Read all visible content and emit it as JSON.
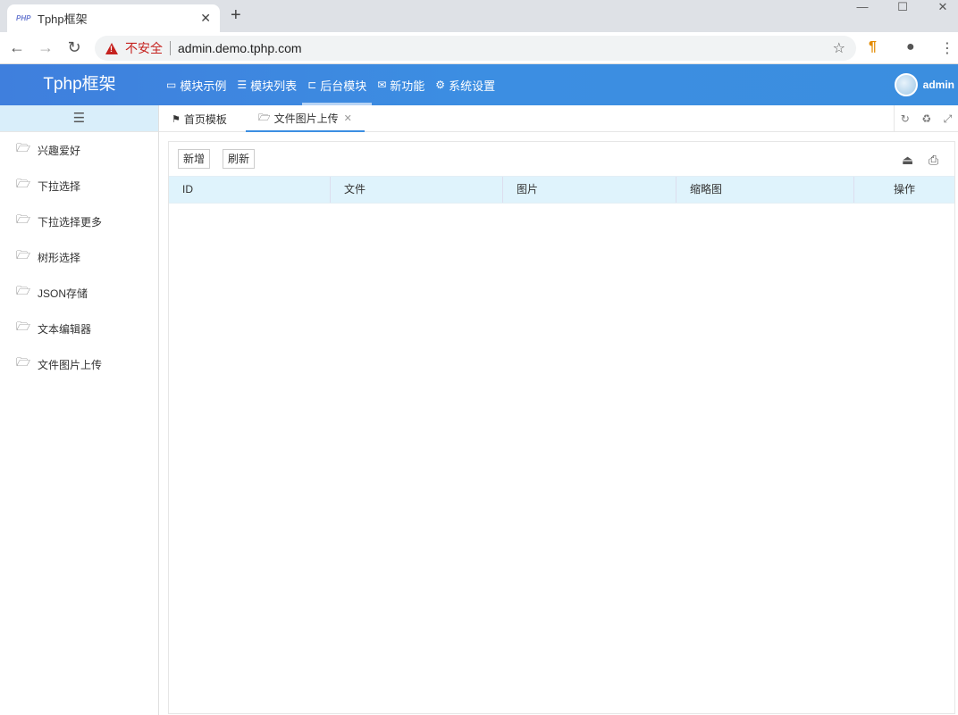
{
  "browser": {
    "tab_title": "Tphp框架",
    "favicon_text": "PHP",
    "security_label": "不安全",
    "url": "admin.demo.tphp.com"
  },
  "header": {
    "logo": "Tphp框架",
    "nav": [
      {
        "label": "模块示例",
        "icon": "monitor-icon"
      },
      {
        "label": "模块列表",
        "icon": "list-icon"
      },
      {
        "label": "后台模块",
        "icon": "laptop-icon",
        "active": true
      },
      {
        "label": "新功能",
        "icon": "envelope-open-icon"
      },
      {
        "label": "系统设置",
        "icon": "gear-icon"
      }
    ],
    "user": "admin"
  },
  "sidebar": {
    "items": [
      {
        "label": "兴趣爱好"
      },
      {
        "label": "下拉选择"
      },
      {
        "label": "下拉选择更多"
      },
      {
        "label": "树形选择"
      },
      {
        "label": "JSON存储"
      },
      {
        "label": "文本编辑器"
      },
      {
        "label": "文件图片上传"
      }
    ]
  },
  "content_tabs": [
    {
      "label": "首页模板",
      "icon": "flag-icon"
    },
    {
      "label": "文件图片上传",
      "icon": "folder-open-icon",
      "active": true
    }
  ],
  "toolbar": {
    "add_label": "新增",
    "refresh_label": "刷新"
  },
  "table": {
    "columns": [
      "ID",
      "文件",
      "图片",
      "缩略图",
      "操作"
    ],
    "rows": []
  },
  "colors": {
    "header_blue": "#3c8ee2",
    "sidebar_toggle_bg": "#d9eefa",
    "table_header_bg": "#dff3fc",
    "insecure_red": "#c5221f"
  }
}
